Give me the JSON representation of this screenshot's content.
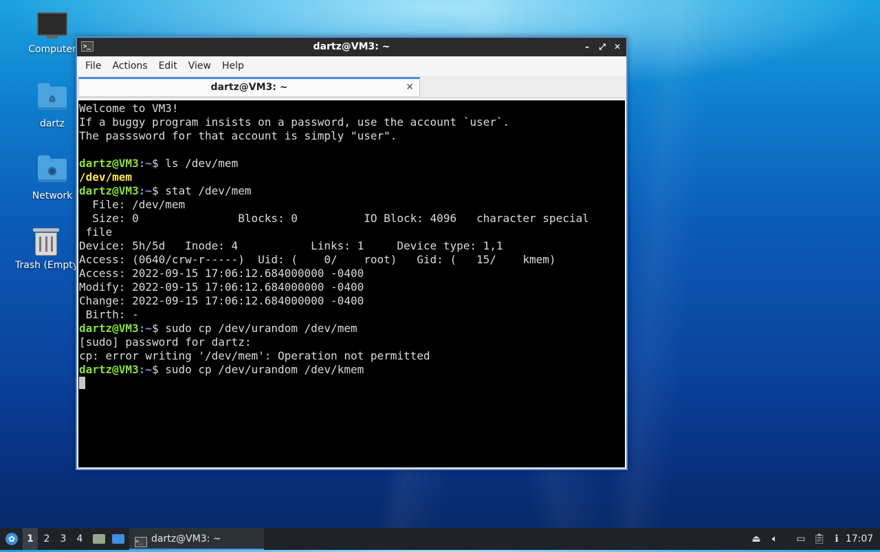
{
  "desktop": {
    "icons": [
      {
        "label": "Computer"
      },
      {
        "label": "dartz"
      },
      {
        "label": "Network"
      },
      {
        "label": "Trash (Empty)"
      }
    ]
  },
  "window": {
    "title": "dartz@VM3: ~",
    "controls": {
      "minimize": "–",
      "maximize": "⤢",
      "close": "✕"
    },
    "menu": [
      "File",
      "Actions",
      "Edit",
      "View",
      "Help"
    ],
    "tab": {
      "label": "dartz@VM3: ~",
      "close": "✕"
    }
  },
  "terminal": {
    "prompt_user": "dartz@VM3",
    "prompt_path": ":~",
    "prompt_symbol": "$",
    "lines": [
      {
        "text": "Welcome to VM3!"
      },
      {
        "text": "If a buggy program insists on a password, use the account `user`."
      },
      {
        "text": "The passsword for that account is simply \"user\"."
      },
      {
        "text": ""
      },
      {
        "cmd": " ls /dev/mem"
      },
      {
        "highlight": "/dev/mem"
      },
      {
        "cmd": " stat /dev/mem"
      },
      {
        "text": "  File: /dev/mem"
      },
      {
        "text": "  Size: 0               Blocks: 0          IO Block: 4096   character special"
      },
      {
        "text": " file"
      },
      {
        "text": "Device: 5h/5d   Inode: 4           Links: 1     Device type: 1,1"
      },
      {
        "text": "Access: (0640/crw-r-----)  Uid: (    0/    root)   Gid: (   15/    kmem)"
      },
      {
        "text": "Access: 2022-09-15 17:06:12.684000000 -0400"
      },
      {
        "text": "Modify: 2022-09-15 17:06:12.684000000 -0400"
      },
      {
        "text": "Change: 2022-09-15 17:06:12.684000000 -0400"
      },
      {
        "text": " Birth: -"
      },
      {
        "cmd": " sudo cp /dev/urandom /dev/mem"
      },
      {
        "text": "[sudo] password for dartz:"
      },
      {
        "text": "cp: error writing '/dev/mem': Operation not permitted"
      },
      {
        "cmd": " sudo cp /dev/urandom /dev/kmem"
      }
    ]
  },
  "taskbar": {
    "workspaces": [
      "1",
      "2",
      "3",
      "4"
    ],
    "active_workspace": "1",
    "task_label": "dartz@VM3: ~",
    "clock": "17:07",
    "colors": {
      "accent": "#4b8ad6",
      "prompt_user": "#8ae234",
      "prompt_path": "#729fcf",
      "highlight": "#fce94f"
    }
  }
}
